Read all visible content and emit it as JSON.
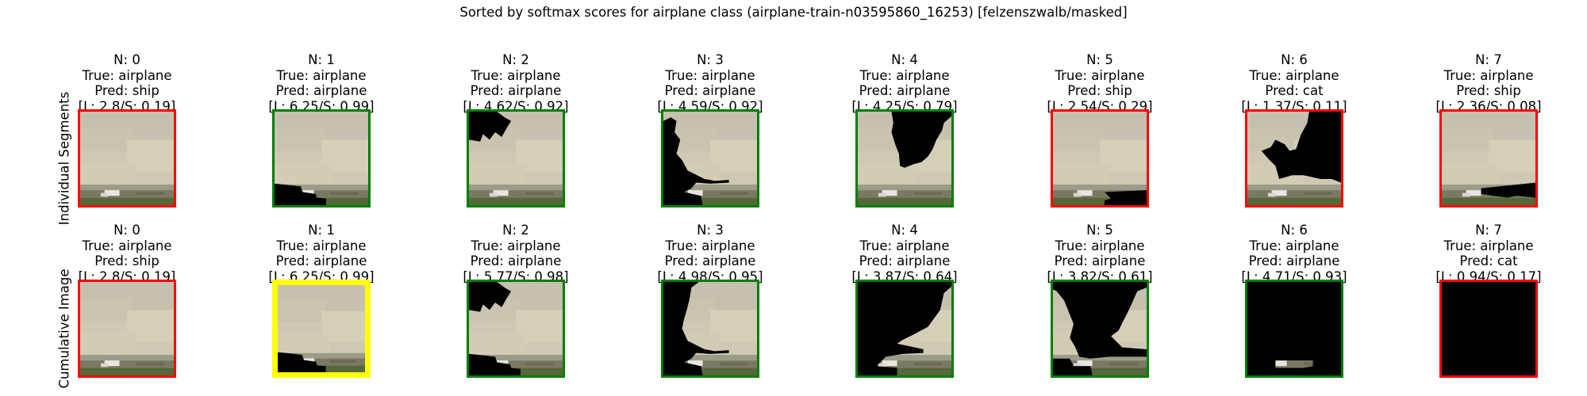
{
  "suptitle": "Sorted by softmax scores for airplane class (airplane-train-n03595860_16253) [felzenszwalb/masked]",
  "colors": {
    "correct": "#007f00",
    "wrong": "#ff0000",
    "best": "#ffff00"
  },
  "rows": [
    {
      "label": "Individual Segments",
      "cells": [
        {
          "n": "N: 0",
          "true": "True: airplane",
          "pred": "Pred: ship",
          "scores": "[L: 2.8/S: 0.19]",
          "outcome": "wrong"
        },
        {
          "n": "N: 1",
          "true": "True: airplane",
          "pred": "Pred: airplane",
          "scores": "[L: 6.25/S: 0.99]",
          "outcome": "correct"
        },
        {
          "n": "N: 2",
          "true": "True: airplane",
          "pred": "Pred: airplane",
          "scores": "[L: 4.62/S: 0.92]",
          "outcome": "correct"
        },
        {
          "n": "N: 3",
          "true": "True: airplane",
          "pred": "Pred: airplane",
          "scores": "[L: 4.59/S: 0.92]",
          "outcome": "correct"
        },
        {
          "n": "N: 4",
          "true": "True: airplane",
          "pred": "Pred: airplane",
          "scores": "[L: 4.25/S: 0.79]",
          "outcome": "correct"
        },
        {
          "n": "N: 5",
          "true": "True: airplane",
          "pred": "Pred: ship",
          "scores": "[L: 2.54/S: 0.29]",
          "outcome": "wrong"
        },
        {
          "n": "N: 6",
          "true": "True: airplane",
          "pred": "Pred: cat",
          "scores": "[L: 1.37/S: 0.11]",
          "outcome": "wrong"
        },
        {
          "n": "N: 7",
          "true": "True: airplane",
          "pred": "Pred: ship",
          "scores": "[L: 2.36/S: 0.08]",
          "outcome": "wrong"
        }
      ]
    },
    {
      "label": "Cumulative Image",
      "cells": [
        {
          "n": "N: 0",
          "true": "True: airplane",
          "pred": "Pred: ship",
          "scores": "[L: 2.8/S: 0.19]",
          "outcome": "wrong"
        },
        {
          "n": "N: 1",
          "true": "True: airplane",
          "pred": "Pred: airplane",
          "scores": "[L: 6.25/S: 0.99]",
          "outcome": "best"
        },
        {
          "n": "N: 2",
          "true": "True: airplane",
          "pred": "Pred: airplane",
          "scores": "[L: 5.77/S: 0.98]",
          "outcome": "correct"
        },
        {
          "n": "N: 3",
          "true": "True: airplane",
          "pred": "Pred: airplane",
          "scores": "[L: 4.98/S: 0.95]",
          "outcome": "correct"
        },
        {
          "n": "N: 4",
          "true": "True: airplane",
          "pred": "Pred: airplane",
          "scores": "[L: 3.87/S: 0.64]",
          "outcome": "correct"
        },
        {
          "n": "N: 5",
          "true": "True: airplane",
          "pred": "Pred: airplane",
          "scores": "[L: 3.82/S: 0.61]",
          "outcome": "correct"
        },
        {
          "n": "N: 6",
          "true": "True: airplane",
          "pred": "Pred: airplane",
          "scores": "[L: 4.71/S: 0.93]",
          "outcome": "correct"
        },
        {
          "n": "N: 7",
          "true": "True: airplane",
          "pred": "Pred: cat",
          "scores": "[L: 0.94/S: 0.17]",
          "outcome": "wrong"
        }
      ]
    }
  ]
}
